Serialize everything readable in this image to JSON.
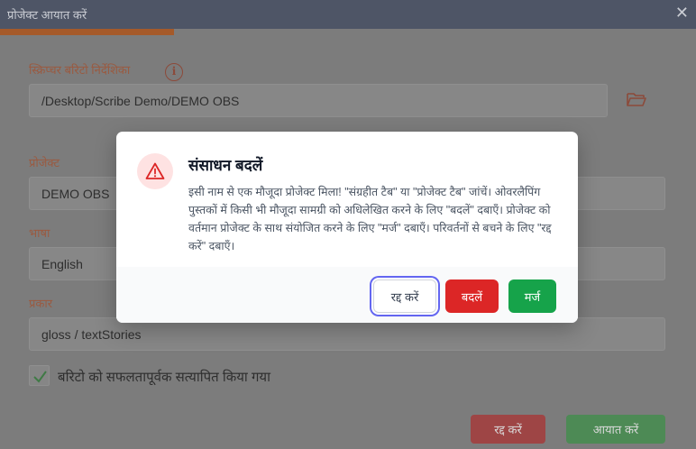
{
  "window": {
    "title": "प्रोजेक्ट आयात करें",
    "close_glyph": "✕",
    "progress_fraction": 0.25
  },
  "form": {
    "directory_label": "स्क्रिप्चर बरिटो निर्देशिका",
    "info_glyph": "i",
    "directory_value": "/Desktop/Scribe Demo/DEMO OBS",
    "project_label": "प्रोजेक्ट",
    "project_value": "DEMO OBS",
    "language_label": "भाषा",
    "language_value": "English",
    "type_label": "प्रकार",
    "type_value": "gloss / textStories",
    "validated_label": "बरिटो को सफलतापूर्वक सत्यापित किया गया",
    "validated_checked": true,
    "cancel_label": "रद्द करें",
    "import_label": "आयात करें"
  },
  "dialog": {
    "title": "संसाधन बदलें",
    "message": "इसी नाम से एक मौजूदा प्रोजेक्ट मिला! \"संग्रहीत टैब\" या \"प्रोजेक्ट टैब\" जांचें। ओवरलैपिंग पुस्तकों में किसी भी मौजूदा सामग्री को अधिलेखित करने के लिए \"बदलें\" दबाएँ। प्रोजेक्ट को वर्तमान प्रोजेक्ट के साथ संयोजित करने के लिए \"मर्ज\" दबाएँ। परिवर्तनों से बचने के लिए \"रद्द करें\" दबाएँ।",
    "cancel_label": "रद्द करें",
    "replace_label": "बदलें",
    "merge_label": "मर्ज"
  },
  "colors": {
    "danger": "#dc2626",
    "success": "#16a34a",
    "focus_ring": "#6366f1"
  },
  "icons": [
    "close-icon",
    "info-icon",
    "folder-icon",
    "check-icon",
    "warning-icon"
  ]
}
